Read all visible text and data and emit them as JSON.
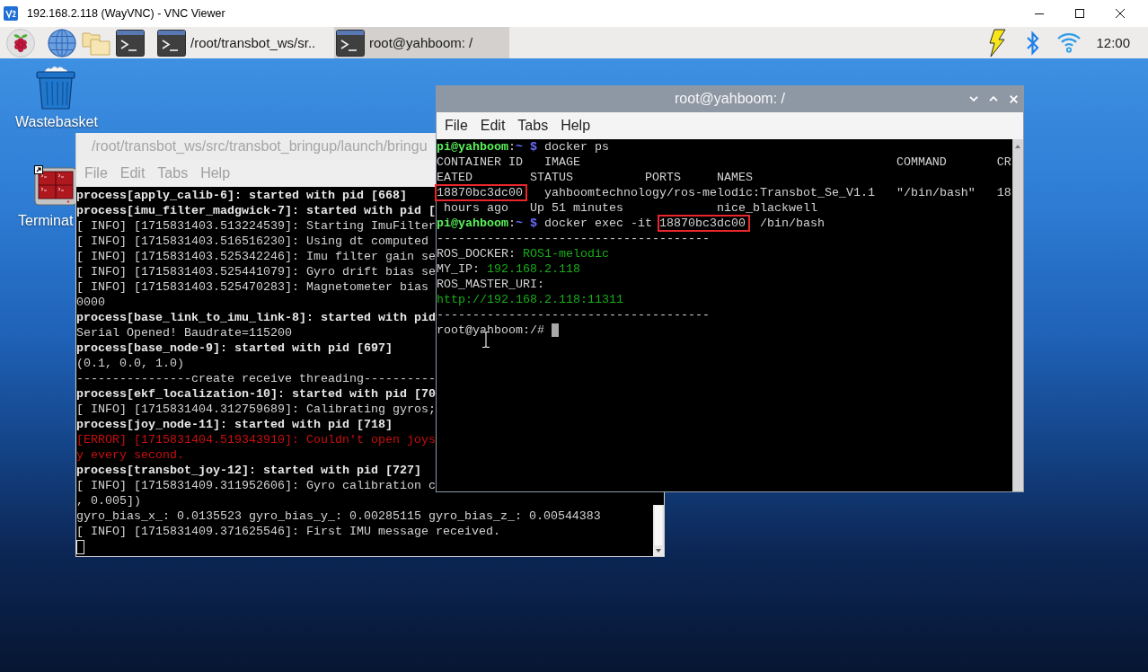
{
  "window": {
    "title": "192.168.2.118 (WayVNC) - VNC Viewer"
  },
  "taskbar": {
    "windows": [
      {
        "label": "/root/transbot_ws/sr..",
        "selected": false
      },
      {
        "label": "root@yahboom: /",
        "selected": true
      }
    ],
    "clock": "12:00"
  },
  "desktop": {
    "icons": [
      {
        "kind": "trash",
        "label": "Wastebasket",
        "shortcut": false
      },
      {
        "kind": "terminal",
        "label": "Terminat",
        "shortcut": true
      }
    ]
  },
  "terminals": [
    {
      "title": "/root/transbot_ws/src/transbot_bringup/launch/bringu",
      "active": false,
      "window_buttons": false,
      "menu": [
        "File",
        "Edit",
        "Tabs",
        "Help"
      ],
      "lines": [
        [
          {
            "kind": "bold",
            "text": "process[apply_calib-6]: started with pid [668]"
          }
        ],
        [
          {
            "kind": "bold",
            "text": "process[imu_filter_madgwick-7]: started with pid ["
          }
        ],
        [
          {
            "kind": "plain",
            "text": "[ INFO] [1715831403.513224539]: Starting ImuFilter"
          }
        ],
        [
          {
            "kind": "plain",
            "text": "[ INFO] [1715831403.516516230]: Using dt computed"
          }
        ],
        [
          {
            "kind": "plain",
            "text": "[ INFO] [1715831403.525342246]: Imu filter gain se"
          }
        ],
        [
          {
            "kind": "plain",
            "text": "[ INFO] [1715831403.525441079]: Gyro drift bias se"
          }
        ],
        [
          {
            "kind": "plain",
            "text": "[ INFO] [1715831403.525470283]: Magnetometer bias"
          }
        ],
        [
          {
            "kind": "plain",
            "text": "0000"
          }
        ],
        [
          {
            "kind": "bold",
            "text": "process[base_link_to_imu_link-8]: started with pid"
          }
        ],
        [
          {
            "kind": "plain",
            "text": "Serial Opened! Baudrate=115200"
          }
        ],
        [
          {
            "kind": "bold",
            "text": "process[base_node-9]: started with pid [697]"
          }
        ],
        [
          {
            "kind": "plain",
            "text": "(0.1, 0.0, 1.0)"
          }
        ],
        [
          {
            "kind": "plain",
            "text": "----------------create receive threading----------"
          }
        ],
        [
          {
            "kind": "bold",
            "text": "process[ekf_localization-10]: started with pid [70"
          }
        ],
        [
          {
            "kind": "plain",
            "text": "[ INFO] [1715831404.312759689]: Calibrating gyros;"
          }
        ],
        [
          {
            "kind": "bold",
            "text": "process[joy_node-11]: started with pid [718]"
          }
        ],
        [
          {
            "kind": "error",
            "text": "[ERROR] [1715831404.519343910]: Couldn't open joys"
          }
        ],
        [
          {
            "kind": "error",
            "text": "y every second."
          }
        ],
        [
          {
            "kind": "bold",
            "text": "process[transbot_joy-12]: started with pid [727]"
          }
        ],
        [
          {
            "kind": "plain",
            "text": "[ INFO] [1715831409.311952606]: Gyro calibration c"
          }
        ],
        [
          {
            "kind": "plain",
            "text": ", 0.005])"
          }
        ],
        [
          {
            "kind": "plain",
            "text": "gyro_bias_x_: 0.0135523 gyro_bias_y_: 0.00285115 gyro_bias_z_: 0.00544383"
          }
        ],
        [
          {
            "kind": "plain",
            "text": "[ INFO] [1715831409.371625546]: First IMU message received."
          }
        ]
      ],
      "input": {
        "cursor": true
      }
    },
    {
      "title": "root@yahboom: /",
      "active": true,
      "window_buttons": true,
      "menu": [
        "File",
        "Edit",
        "Tabs",
        "Help"
      ],
      "lines": [
        [
          {
            "kind": "user",
            "text": "pi@yahboom"
          },
          {
            "kind": "plain",
            "text": ":"
          },
          {
            "kind": "path",
            "text": "~ $"
          },
          {
            "kind": "plain",
            "text": " docker ps"
          }
        ],
        [
          {
            "kind": "plain",
            "text": "CONTAINER ID   IMAGE                                            COMMAND       CR"
          }
        ],
        [
          {
            "kind": "plain",
            "text": "EATED        STATUS          PORTS     NAMES"
          }
        ],
        [
          {
            "kind": "marked",
            "text": "18870bc3dc00"
          },
          {
            "kind": "plain",
            "text": "   yahboomtechnology/ros-melodic:Transbot_Se_V1.1   \"/bin/bash\"   18"
          }
        ],
        [
          {
            "kind": "plain",
            "text": " hours ago   Up 51 minutes             nice_blackwell"
          }
        ],
        [
          {
            "kind": "user",
            "text": "pi@yahboom"
          },
          {
            "kind": "plain",
            "text": ":"
          },
          {
            "kind": "path",
            "text": "~ $"
          },
          {
            "kind": "plain",
            "text": " docker exec -it "
          },
          {
            "kind": "marked",
            "text": "18870bc3dc00"
          },
          {
            "kind": "plain",
            "text": "  /bin/bash"
          }
        ],
        [
          {
            "kind": "plain",
            "text": "--------------------------------------"
          }
        ],
        [
          {
            "kind": "plain",
            "text": "ROS_DOCKER: "
          },
          {
            "kind": "output",
            "text": "ROS1-melodic"
          }
        ],
        [
          {
            "kind": "plain",
            "text": "MY_IP: "
          },
          {
            "kind": "output",
            "text": "192.168.2.118"
          }
        ],
        [
          {
            "kind": "plain",
            "text": "ROS_MASTER_URI:"
          }
        ],
        [
          {
            "kind": "output",
            "text": "http://192.168.2.118:11311"
          }
        ],
        [
          {
            "kind": "plain",
            "text": "--------------------------------------"
          }
        ]
      ],
      "input": {
        "prompt": "root@yahboom:/# ",
        "cursor": true
      }
    }
  ]
}
